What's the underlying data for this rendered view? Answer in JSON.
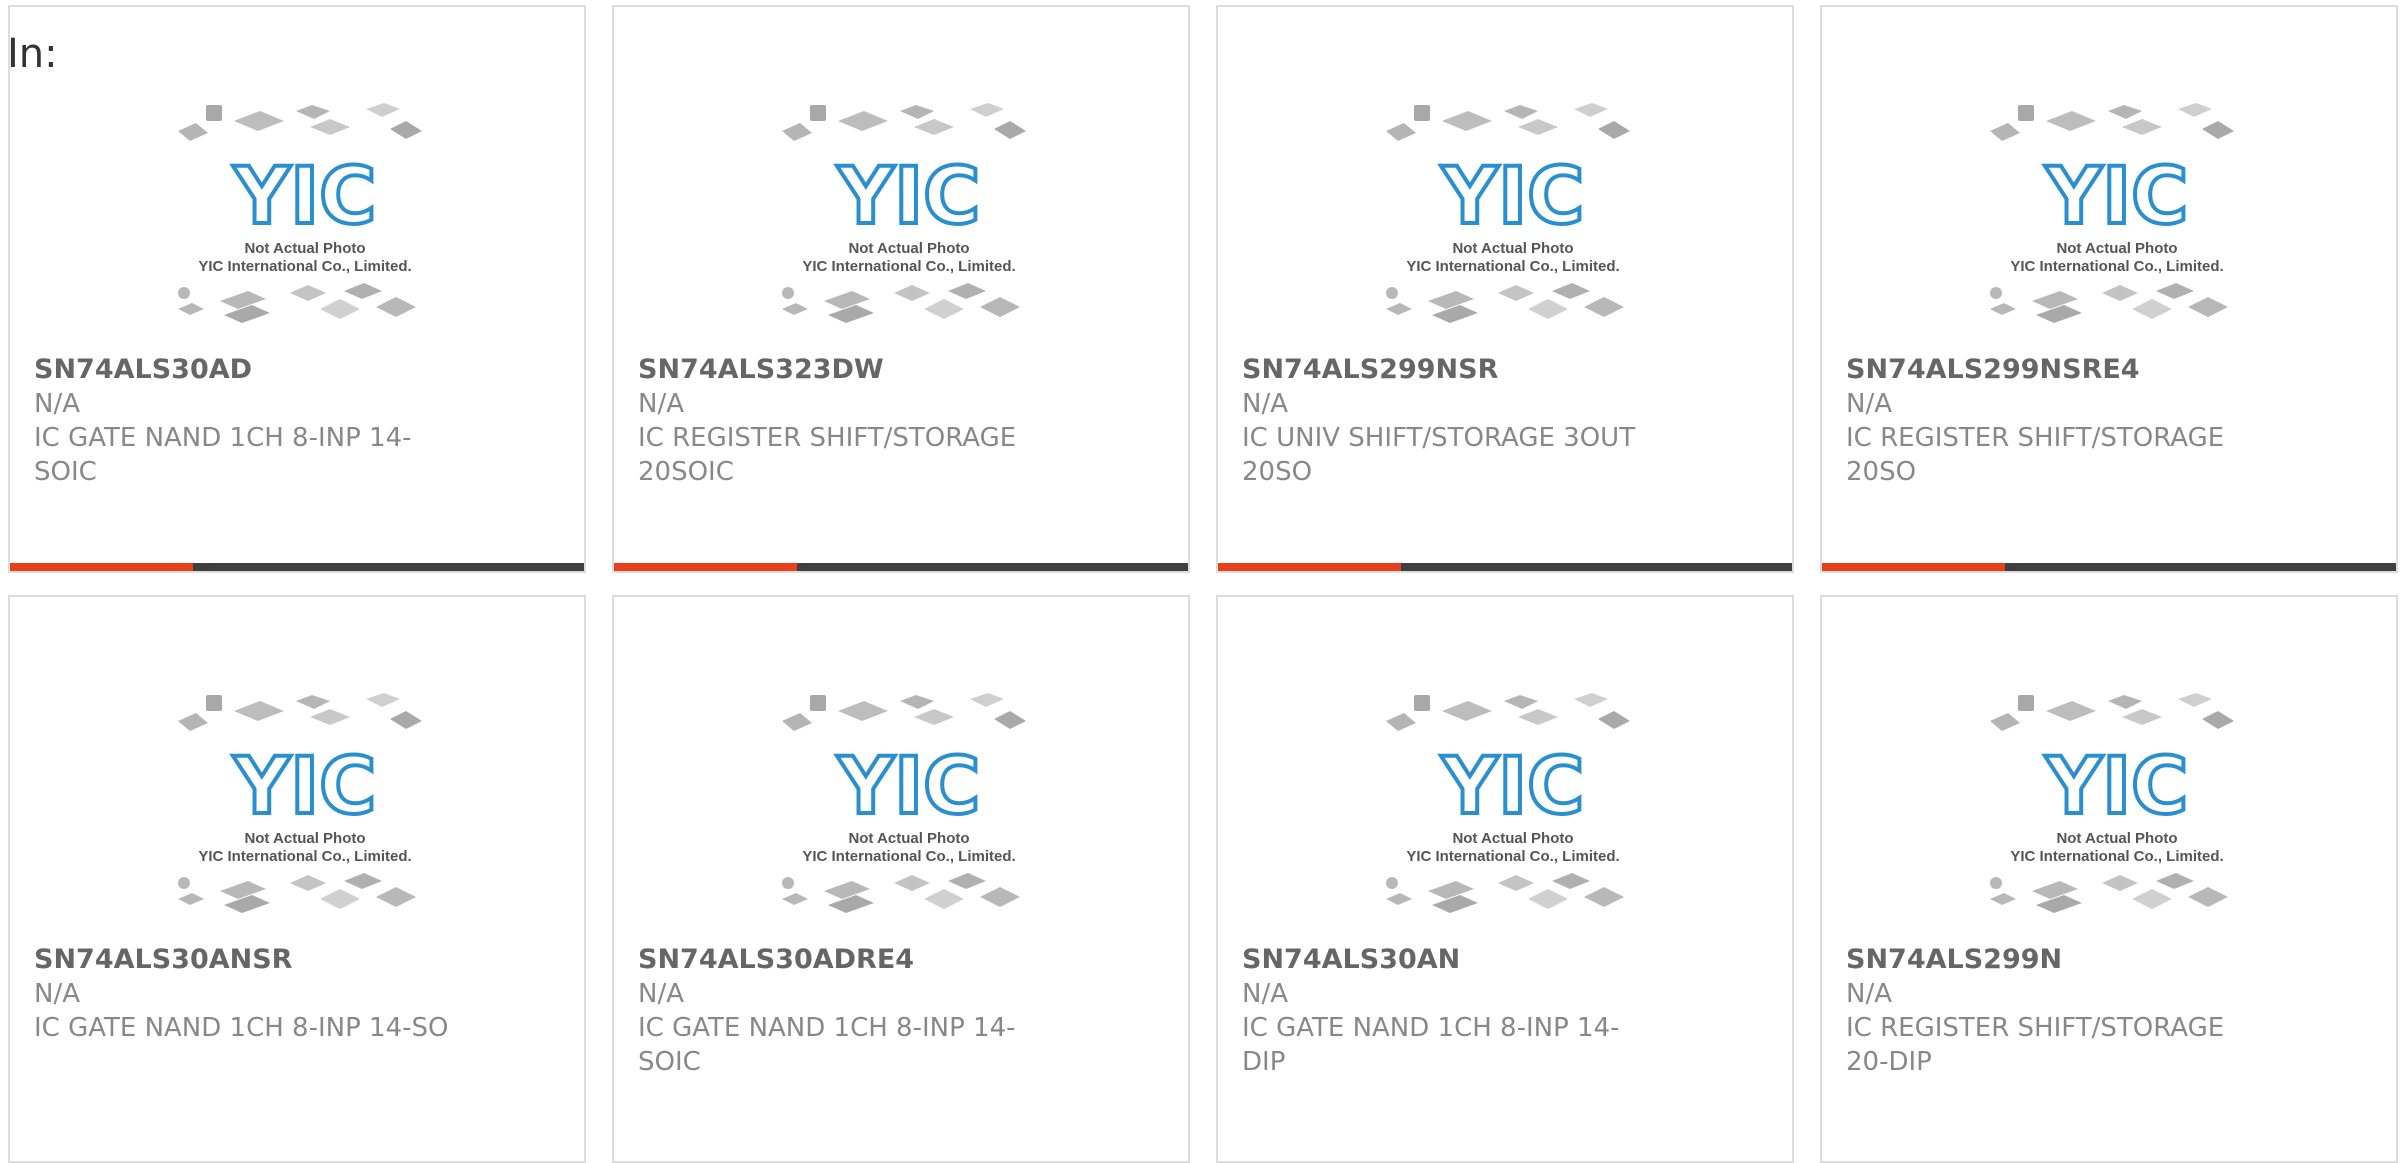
{
  "header": {
    "in_label": "In:"
  },
  "photo": {
    "line1": "Not Actual Photo",
    "line2": "YIC International Co., Limited.",
    "logo_text": "YIC"
  },
  "colors": {
    "accent": "#e8401c",
    "bar": "#3f3f3f",
    "logo": "#2a8fd0",
    "border": "#dddddd"
  },
  "products": [
    {
      "part_number": "SN74ALS30AD",
      "manufacturer": "N/A",
      "description": "IC GATE NAND 1CH 8-INP 14-SOIC"
    },
    {
      "part_number": "SN74ALS323DW",
      "manufacturer": "N/A",
      "description": "IC REGISTER SHIFT/STORAGE 20SOIC"
    },
    {
      "part_number": "SN74ALS299NSR",
      "manufacturer": "N/A",
      "description": "IC UNIV SHIFT/STORAGE 3OUT 20SO"
    },
    {
      "part_number": "SN74ALS299NSRE4",
      "manufacturer": "N/A",
      "description": "IC REGISTER SHIFT/STORAGE 20SO"
    },
    {
      "part_number": "SN74ALS30ANSR",
      "manufacturer": "N/A",
      "description": "IC GATE NAND 1CH 8-INP 14-SO"
    },
    {
      "part_number": "SN74ALS30ADRE4",
      "manufacturer": "N/A",
      "description": "IC GATE NAND 1CH 8-INP 14-SOIC"
    },
    {
      "part_number": "SN74ALS30AN",
      "manufacturer": "N/A",
      "description": "IC GATE NAND 1CH 8-INP 14-DIP"
    },
    {
      "part_number": "SN74ALS299N",
      "manufacturer": "N/A",
      "description": "IC REGISTER SHIFT/STORAGE 20-DIP"
    }
  ]
}
